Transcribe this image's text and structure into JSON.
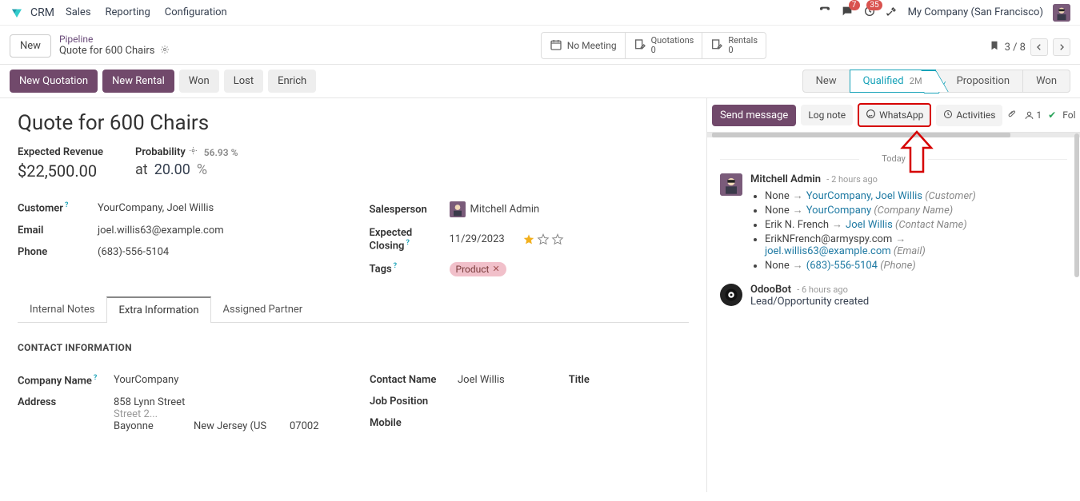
{
  "nav": {
    "app": "CRM",
    "links": [
      "Sales",
      "Reporting",
      "Configuration"
    ],
    "chat_badge": "7",
    "activity_badge": "35",
    "company": "My Company (San Francisco)"
  },
  "crumb": {
    "new_btn": "New",
    "parent": "Pipeline",
    "title": "Quote for 600 Chairs",
    "stats": {
      "meeting_label": "No Meeting",
      "quotations_label": "Quotations",
      "quotations_count": "0",
      "rentals_label": "Rentals",
      "rentals_count": "0"
    },
    "pager": "3 / 8"
  },
  "actions": {
    "new_quotation": "New Quotation",
    "new_rental": "New Rental",
    "won": "Won",
    "lost": "Lost",
    "enrich": "Enrich",
    "stages": {
      "new": "New",
      "qualified": "Qualified",
      "qualified_dur": "2M",
      "proposition": "Proposition",
      "won": "Won"
    }
  },
  "record": {
    "title": "Quote for 600 Chairs",
    "exp_rev_label": "Expected Revenue",
    "exp_rev_value": "$22,500.00",
    "at_label": "at",
    "prob_label": "Probability",
    "prob_est": "56.93 %",
    "prob_value": "20.00",
    "prob_unit": "%",
    "left_fields": {
      "customer_label": "Customer",
      "customer_value": "YourCompany, Joel Willis",
      "email_label": "Email",
      "email_value": "joel.willis63@example.com",
      "phone_label": "Phone",
      "phone_value": "(683)-556-5104"
    },
    "right_fields": {
      "salesperson_label": "Salesperson",
      "salesperson_value": "Mitchell Admin",
      "closing_label": "Expected Closing",
      "closing_value": "11/29/2023",
      "tags_label": "Tags",
      "tag_value": "Product"
    },
    "tabs": {
      "notes": "Internal Notes",
      "extra": "Extra Information",
      "partner": "Assigned Partner"
    },
    "contact_section": "CONTACT INFORMATION",
    "company_name_label": "Company Name",
    "company_name_value": "YourCompany",
    "address_label": "Address",
    "addr_street": "858 Lynn Street",
    "addr_street2": "Street 2...",
    "addr_city": "Bayonne",
    "addr_state": "New Jersey (US",
    "addr_zip": "07002",
    "contact_name_label": "Contact Name",
    "contact_name_value": "Joel Willis",
    "title_label": "Title",
    "job_label": "Job Position",
    "mobile_label": "Mobile"
  },
  "chatter": {
    "send": "Send message",
    "log": "Log note",
    "whatsapp": "WhatsApp",
    "activities": "Activities",
    "follower_count": "1",
    "follow": "Fol",
    "today": "Today",
    "msg1": {
      "author": "Mitchell Admin",
      "time": "- 2 hours ago",
      "c1_old": "None",
      "c1_new": "YourCompany, Joel Willis",
      "c1_field": "(Customer)",
      "c2_old": "None",
      "c2_new": "YourCompany",
      "c2_field": "(Company Name)",
      "c3_old": "Erik N. French",
      "c3_new": "Joel Willis",
      "c3_field": "(Contact Name)",
      "c4_old": "ErikNFrench@armyspy.com",
      "c4_new": "joel.willis63@example.com",
      "c4_field": "(Email)",
      "c5_old": "None",
      "c5_new": "(683)-556-5104",
      "c5_field": "(Phone)"
    },
    "msg2": {
      "author": "OdooBot",
      "time": "- 6 hours ago",
      "body": "Lead/Opportunity created"
    }
  }
}
